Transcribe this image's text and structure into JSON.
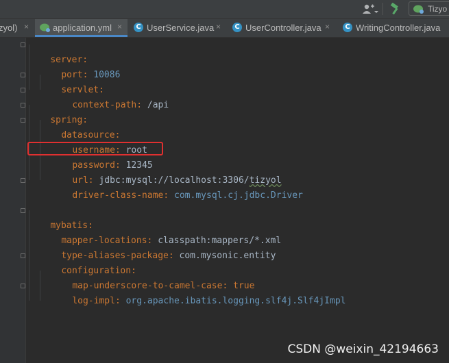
{
  "toolbar": {
    "run_config_label": "Tizyo"
  },
  "tabs": [
    {
      "label": "zyol)",
      "close": "×"
    },
    {
      "label": "application.yml",
      "close": "×"
    },
    {
      "label": "UserService.java",
      "close": "×"
    },
    {
      "label": "UserController.java",
      "close": "×"
    },
    {
      "label": "WritingController.java",
      "close": "×"
    }
  ],
  "code": {
    "l1": {
      "key": "server",
      "colon": ":"
    },
    "l2": {
      "key": "port",
      "colon": ":",
      "value": " 10086"
    },
    "l3": {
      "key": "servlet",
      "colon": ":"
    },
    "l4": {
      "key": "context-path",
      "colon": ":",
      "value": " /api"
    },
    "l5": {
      "key": "spring",
      "colon": ":"
    },
    "l6": {
      "key": "datasource",
      "colon": ":"
    },
    "l7": {
      "key": "username",
      "colon": ":",
      "value": " root"
    },
    "l8": {
      "key": "password",
      "colon": ":",
      "value": " 12345"
    },
    "l9": {
      "key": "url",
      "colon": ":",
      "value": " jdbc:mysql://localhost:3306/",
      "value2": "tizyol"
    },
    "l10": {
      "key": "driver-class-name",
      "colon": ":",
      "value": " com.mysql.cj.jdbc.Driver"
    },
    "l12": {
      "key": "mybatis",
      "colon": ":"
    },
    "l13": {
      "key": "mapper-locations",
      "colon": ":",
      "value": " classpath:mappers/*.xml"
    },
    "l14": {
      "key": "type-aliases-package",
      "colon": ":",
      "value": " com.mysonic.entity"
    },
    "l15": {
      "key": "configuration",
      "colon": ":"
    },
    "l16": {
      "key": "map-underscore-to-camel-case",
      "colon": ":",
      "value": " true"
    },
    "l17": {
      "key": "log-impl",
      "colon": ":",
      "value": " org.apache.ibatis.logging.slf4j.Slf4jImpl"
    }
  },
  "watermark": "CSDN @weixin_42194663",
  "colors": {
    "key": "#cc7832",
    "value": "#a9b7c6",
    "number": "#6897bb",
    "highlight": "#e03030",
    "background": "#2b2b2b"
  }
}
